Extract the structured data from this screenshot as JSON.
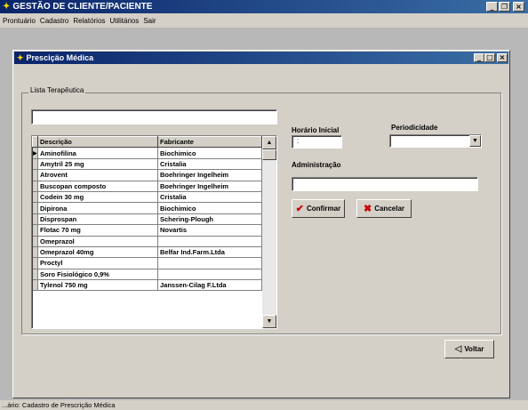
{
  "app": {
    "title": "GESTÃO DE CLIENTE/PACIENTE",
    "menu": [
      "Prontuário",
      "Cadastro",
      "Relatórios",
      "Utilitários",
      "Sair"
    ]
  },
  "dialog": {
    "title": "Presciçäo Médica",
    "group_label": "Lista Terapêutica",
    "filter_value": "",
    "columns": [
      "Descrição",
      "Fabricante"
    ],
    "rows": [
      {
        "descricao": "Aminofilina",
        "fabricante": "Biochimico"
      },
      {
        "descricao": "Amytril 25 mg",
        "fabricante": "Cristalia"
      },
      {
        "descricao": "Atrovent",
        "fabricante": "Boehringer Ingelheim"
      },
      {
        "descricao": "Buscopan composto",
        "fabricante": "Boehringer Ingelheim"
      },
      {
        "descricao": "Codein 30 mg",
        "fabricante": "Cristalia"
      },
      {
        "descricao": "Dipirona",
        "fabricante": "Biochimico"
      },
      {
        "descricao": "Disprospan",
        "fabricante": "Schering-Plough"
      },
      {
        "descricao": "Flotac 70 mg",
        "fabricante": "Novartis"
      },
      {
        "descricao": "Omeprazol",
        "fabricante": ""
      },
      {
        "descricao": "Omeprazol 40mg",
        "fabricante": "Belfar Ind.Farm.Ltda"
      },
      {
        "descricao": "Proctyl",
        "fabricante": ""
      },
      {
        "descricao": "Soro Fisiológico 0,9%",
        "fabricante": ""
      },
      {
        "descricao": "Tylenol 750 mg",
        "fabricante": "Janssen-Cilag F.Ltda"
      }
    ],
    "horario_label": "Horário Inicial",
    "horario_value": ":",
    "periodicidade_label": "Periodicidade",
    "periodicidade_value": "",
    "administracao_label": "Administração",
    "administracao_value": "",
    "confirm_label": "Confirmar",
    "cancel_label": "Cancelar",
    "back_label": "Voltar"
  },
  "statusbar": {
    "text": "...ário: Cadastro de Prescrição Médica"
  },
  "colors": {
    "titlebar_start": "#0a246a",
    "titlebar_end": "#3a6ea5",
    "face": "#d4d0c8",
    "confirm_check": "#cc0000",
    "cancel_x": "#cc0000"
  }
}
